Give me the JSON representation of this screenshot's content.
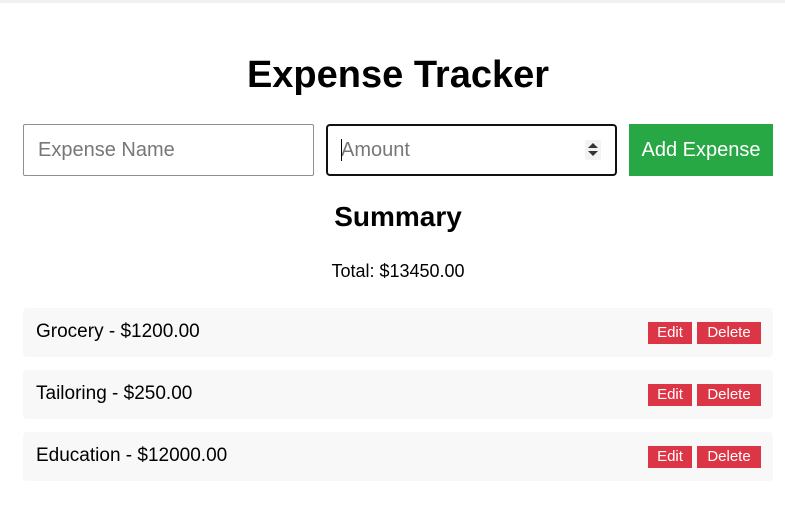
{
  "app": {
    "title": "Expense Tracker"
  },
  "form": {
    "name_placeholder": "Expense Name",
    "name_value": "",
    "amount_placeholder": "Amount",
    "amount_value": "",
    "add_label": "Add Expense"
  },
  "summary": {
    "title": "Summary",
    "total": "Total: $13450.00"
  },
  "expenses": [
    {
      "text": "Grocery - $1200.00",
      "edit_label": "Edit",
      "delete_label": "Delete"
    },
    {
      "text": "Tailoring - $250.00",
      "edit_label": "Edit",
      "delete_label": "Delete"
    },
    {
      "text": "Education - $12000.00",
      "edit_label": "Edit",
      "delete_label": "Delete"
    }
  ],
  "colors": {
    "add_button": "#28a745",
    "delete_button": "#dc3545",
    "item_background": "#f8f8f8"
  },
  "icons": {
    "spinner": "spinner-arrows-icon"
  }
}
